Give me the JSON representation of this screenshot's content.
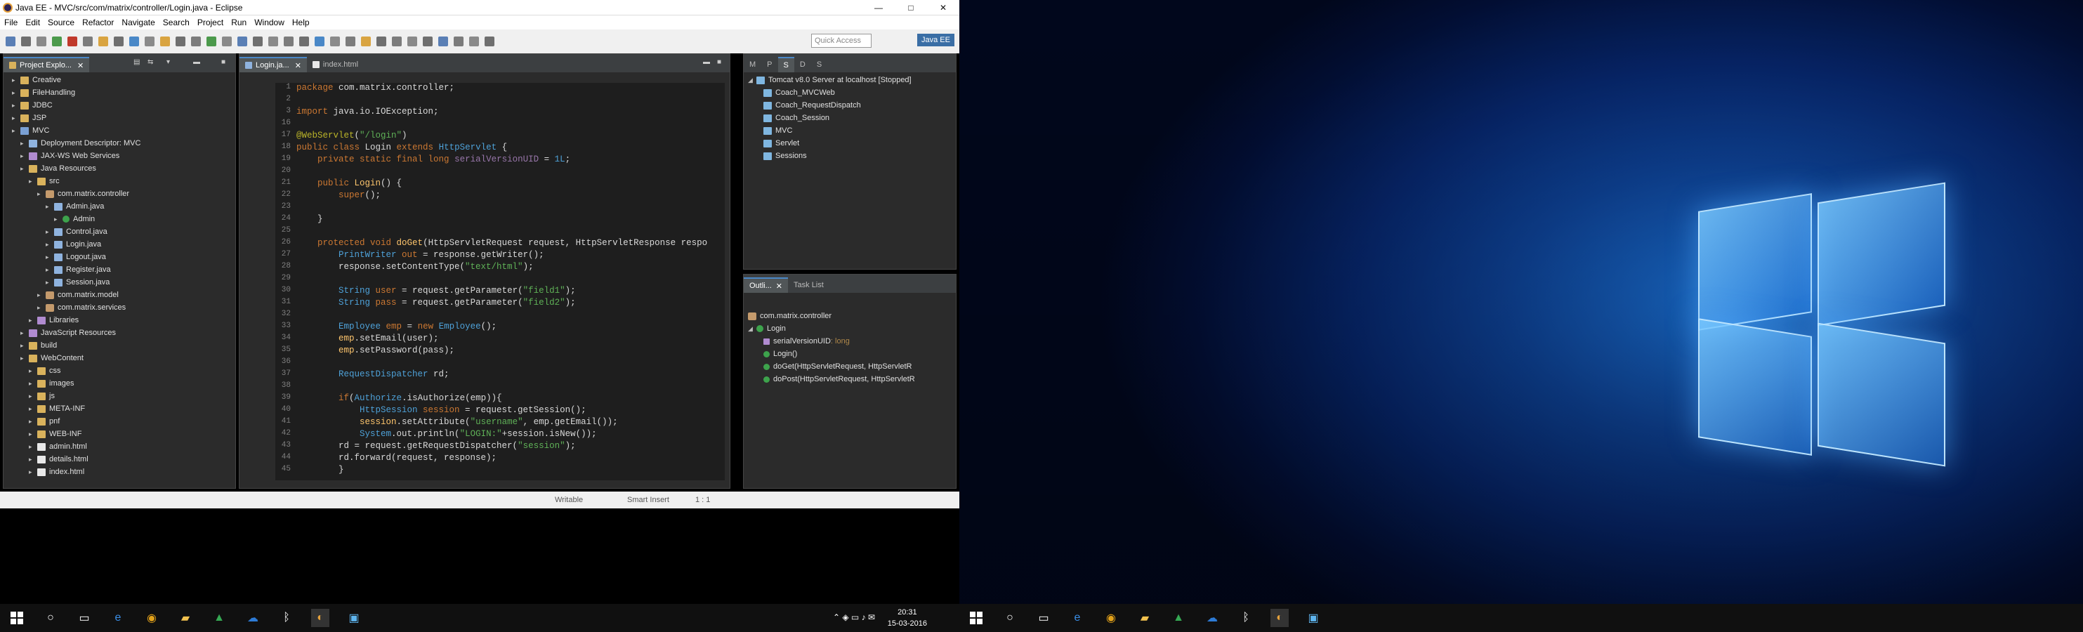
{
  "window": {
    "title": "Java EE - MVC/src/com/matrix/controller/Login.java - Eclipse",
    "min": "—",
    "max": "□",
    "close": "✕"
  },
  "menu": [
    "File",
    "Edit",
    "Source",
    "Refactor",
    "Navigate",
    "Search",
    "Project",
    "Run",
    "Window",
    "Help"
  ],
  "toolbar": {
    "quick_access_placeholder": "Quick Access",
    "perspective": "Java EE"
  },
  "project_explorer": {
    "tab_label": "Project Explo...",
    "items": [
      {
        "label": "Creative",
        "icon": "folder-icon",
        "indent": 1
      },
      {
        "label": "FileHandling",
        "icon": "folder-icon",
        "indent": 1
      },
      {
        "label": "JDBC",
        "icon": "folder-icon",
        "indent": 1
      },
      {
        "label": "JSP",
        "icon": "folder-icon",
        "indent": 1
      },
      {
        "label": "MVC",
        "icon": "project-icon",
        "indent": 1
      },
      {
        "label": "Deployment Descriptor: MVC",
        "icon": "descriptor-icon",
        "indent": 2
      },
      {
        "label": "JAX-WS Web Services",
        "icon": "webservice-icon",
        "indent": 2
      },
      {
        "label": "Java Resources",
        "icon": "folder-icon",
        "indent": 2
      },
      {
        "label": "src",
        "icon": "folder-icon",
        "indent": 3
      },
      {
        "label": "com.matrix.controller",
        "icon": "package-icon",
        "indent": 4
      },
      {
        "label": "Admin.java",
        "icon": "java-file-icon",
        "indent": 5
      },
      {
        "label": "Admin",
        "icon": "class-icon",
        "indent": 6
      },
      {
        "label": "Control.java",
        "icon": "java-file-icon",
        "indent": 5
      },
      {
        "label": "Login.java",
        "icon": "java-file-icon",
        "indent": 5
      },
      {
        "label": "Logout.java",
        "icon": "java-file-icon",
        "indent": 5
      },
      {
        "label": "Register.java",
        "icon": "java-file-icon",
        "indent": 5
      },
      {
        "label": "Session.java",
        "icon": "java-file-icon",
        "indent": 5
      },
      {
        "label": "com.matrix.model",
        "icon": "package-icon",
        "indent": 4
      },
      {
        "label": "com.matrix.services",
        "icon": "package-icon",
        "indent": 4
      },
      {
        "label": "Libraries",
        "icon": "library-icon",
        "indent": 3
      },
      {
        "label": "JavaScript Resources",
        "icon": "library-icon",
        "indent": 2
      },
      {
        "label": "build",
        "icon": "folder-icon",
        "indent": 2
      },
      {
        "label": "WebContent",
        "icon": "folder-icon",
        "indent": 2
      },
      {
        "label": "css",
        "icon": "folder-icon",
        "indent": 3
      },
      {
        "label": "images",
        "icon": "folder-icon",
        "indent": 3
      },
      {
        "label": "js",
        "icon": "folder-icon",
        "indent": 3
      },
      {
        "label": "META-INF",
        "icon": "folder-icon",
        "indent": 3
      },
      {
        "label": "pnf",
        "icon": "folder-icon",
        "indent": 3
      },
      {
        "label": "WEB-INF",
        "icon": "folder-icon",
        "indent": 3
      },
      {
        "label": "admin.html",
        "icon": "html-file-icon",
        "indent": 3
      },
      {
        "label": "details.html",
        "icon": "html-file-icon",
        "indent": 3
      },
      {
        "label": "index.html",
        "icon": "html-file-icon",
        "indent": 3
      }
    ]
  },
  "editor": {
    "tabs": [
      "Login.ja...",
      "index.html"
    ],
    "lines": [
      {
        "n": "1",
        "t": [
          [
            "kw",
            "package "
          ],
          [
            "",
            "com.matrix.controller;"
          ]
        ]
      },
      {
        "n": "2",
        "t": []
      },
      {
        "n": "3",
        "t": [
          [
            "kw",
            "import "
          ],
          [
            "",
            "java.io.IOException;"
          ]
        ]
      },
      {
        "n": "16",
        "t": []
      },
      {
        "n": "17",
        "t": [
          [
            "ann",
            "@WebServlet"
          ],
          [
            "",
            "("
          ],
          [
            "str",
            "\"/login\""
          ],
          [
            "",
            ")"
          ]
        ]
      },
      {
        "n": "18",
        "t": [
          [
            "kw",
            "public class "
          ],
          [
            "",
            "Login "
          ],
          [
            "kw",
            "extends "
          ],
          [
            "ty",
            "HttpServlet"
          ],
          [
            "",
            " {"
          ]
        ]
      },
      {
        "n": "19",
        "t": [
          [
            "",
            "    "
          ],
          [
            "kw",
            "private static final long "
          ],
          [
            "fld",
            "serialVersionUID"
          ],
          [
            "",
            " = "
          ],
          [
            "ty",
            "1L"
          ],
          [
            "",
            ";"
          ]
        ]
      },
      {
        "n": "20",
        "t": []
      },
      {
        "n": "21",
        "t": [
          [
            "",
            "    "
          ],
          [
            "kw",
            "public "
          ],
          [
            "mth",
            "Login"
          ],
          [
            "",
            "() {"
          ]
        ]
      },
      {
        "n": "22",
        "t": [
          [
            "",
            "        "
          ],
          [
            "kw",
            "super"
          ],
          [
            "",
            "();"
          ]
        ]
      },
      {
        "n": "23",
        "t": []
      },
      {
        "n": "24",
        "t": [
          [
            "",
            "    }"
          ]
        ]
      },
      {
        "n": "25",
        "t": []
      },
      {
        "n": "26",
        "t": [
          [
            "",
            "    "
          ],
          [
            "kw",
            "protected void "
          ],
          [
            "mth",
            "doGet"
          ],
          [
            "",
            "(HttpServletRequest request, HttpServletResponse respo"
          ]
        ]
      },
      {
        "n": "27",
        "t": [
          [
            "",
            "        "
          ],
          [
            "ty",
            "PrintWriter"
          ],
          [
            "kw",
            " out"
          ],
          [
            "",
            " = response.getWriter();"
          ]
        ]
      },
      {
        "n": "28",
        "t": [
          [
            "",
            "        response.setContentType("
          ],
          [
            "str",
            "\"text/html\""
          ],
          [
            "",
            ");"
          ]
        ]
      },
      {
        "n": "29",
        "t": []
      },
      {
        "n": "30",
        "t": [
          [
            "",
            "        "
          ],
          [
            "ty",
            "String"
          ],
          [
            "kw",
            " user"
          ],
          [
            "",
            " = request.getParameter("
          ],
          [
            "str",
            "\"field1\""
          ],
          [
            "",
            ");"
          ]
        ]
      },
      {
        "n": "31",
        "t": [
          [
            "",
            "        "
          ],
          [
            "ty",
            "String"
          ],
          [
            "kw",
            " pass"
          ],
          [
            "",
            " = request.getParameter("
          ],
          [
            "str",
            "\"field2\""
          ],
          [
            "",
            ");"
          ]
        ]
      },
      {
        "n": "32",
        "t": []
      },
      {
        "n": "33",
        "t": [
          [
            "",
            "        "
          ],
          [
            "ty",
            "Employee"
          ],
          [
            "kw",
            " emp"
          ],
          [
            "",
            " = "
          ],
          [
            "kw",
            "new "
          ],
          [
            "ty",
            "Employee"
          ],
          [
            "",
            "();"
          ]
        ]
      },
      {
        "n": "34",
        "t": [
          [
            "",
            "        "
          ],
          [
            "mth",
            "emp"
          ],
          [
            "",
            ".setEmail(user);"
          ]
        ]
      },
      {
        "n": "35",
        "t": [
          [
            "",
            "        "
          ],
          [
            "mth",
            "emp"
          ],
          [
            "",
            ".setPassword(pass);"
          ]
        ]
      },
      {
        "n": "36",
        "t": []
      },
      {
        "n": "37",
        "t": [
          [
            "",
            "        "
          ],
          [
            "ty",
            "RequestDispatcher"
          ],
          [
            "",
            " rd;"
          ]
        ]
      },
      {
        "n": "38",
        "t": []
      },
      {
        "n": "39",
        "t": [
          [
            "",
            "        "
          ],
          [
            "kw",
            "if"
          ],
          [
            "",
            "("
          ],
          [
            "ty",
            "Authorize"
          ],
          [
            "",
            ".isAuthorize(emp)){"
          ]
        ]
      },
      {
        "n": "40",
        "t": [
          [
            "",
            "            "
          ],
          [
            "ty",
            "HttpSession"
          ],
          [
            "kw",
            " session"
          ],
          [
            "",
            " = request.getSession();"
          ]
        ]
      },
      {
        "n": "41",
        "t": [
          [
            "",
            "            "
          ],
          [
            "mth",
            "session"
          ],
          [
            "",
            ".setAttribute("
          ],
          [
            "str",
            "\"username\""
          ],
          [
            "",
            ", emp.getEmail());"
          ]
        ]
      },
      {
        "n": "42",
        "t": [
          [
            "",
            "            "
          ],
          [
            "ty",
            "System"
          ],
          [
            "",
            ".out.println("
          ],
          [
            "str",
            "\"LOGIN:\""
          ],
          [
            "",
            "+session.isNew());"
          ]
        ]
      },
      {
        "n": "43",
        "t": [
          [
            "",
            "        rd = request.getRequestDispatcher("
          ],
          [
            "str",
            "\"session\""
          ],
          [
            "",
            ");"
          ]
        ]
      },
      {
        "n": "44",
        "t": [
          [
            "",
            "        rd.forward(request, response);"
          ]
        ]
      },
      {
        "n": "45",
        "t": [
          [
            "",
            "        }"
          ]
        ]
      }
    ]
  },
  "servers": {
    "tabs": [
      "M",
      "P",
      "S",
      "D",
      "S"
    ],
    "root": "Tomcat v8.0 Server at localhost  [Stopped]",
    "modules": [
      "Coach_MVCWeb",
      "Coach_RequestDispatch",
      "Coach_Session",
      "MVC",
      "Servlet",
      "Sessions"
    ]
  },
  "outline": {
    "tabs": [
      "Outli...",
      "Task List"
    ],
    "package": "com.matrix.controller",
    "class": "Login",
    "members": [
      {
        "label": "serialVersionUID",
        "type": " : long"
      },
      {
        "label": "Login()",
        "type": ""
      },
      {
        "label": "doGet(HttpServletRequest, HttpServletR",
        "type": ""
      },
      {
        "label": "doPost(HttpServletRequest, HttpServletR",
        "type": ""
      }
    ]
  },
  "status": {
    "writable": "Writable",
    "insert": "Smart Insert",
    "position": "1 : 1"
  },
  "taskbar": {
    "time": "20:31",
    "date": "15-03-2016"
  }
}
